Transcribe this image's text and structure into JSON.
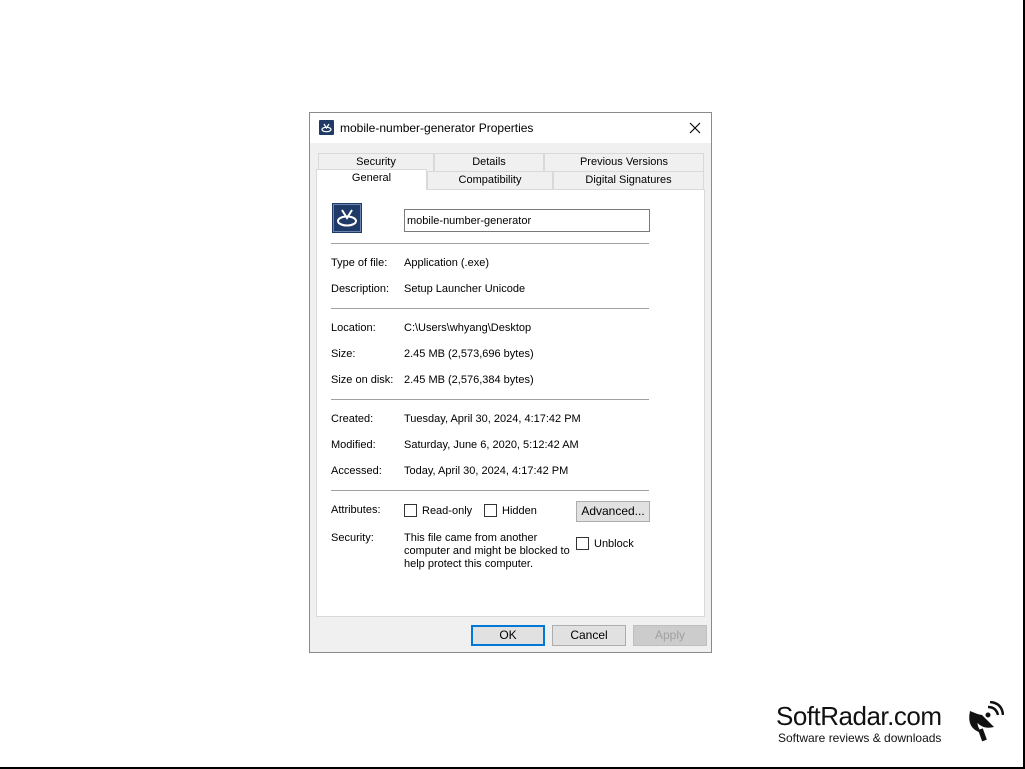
{
  "window": {
    "title": "mobile-number-generator Properties"
  },
  "tabs_row1": [
    "Security",
    "Details",
    "Previous Versions"
  ],
  "tabs_row2": [
    "General",
    "Compatibility",
    "Digital Signatures"
  ],
  "general": {
    "file_name": "mobile-number-generator",
    "type_label": "Type of file:",
    "type_value": "Application (.exe)",
    "description_label": "Description:",
    "description_value": "Setup Launcher Unicode",
    "location_label": "Location:",
    "location_value": "C:\\Users\\whyang\\Desktop",
    "size_label": "Size:",
    "size_value": "2.45 MB (2,573,696 bytes)",
    "size_on_disk_label": "Size on disk:",
    "size_on_disk_value": "2.45 MB (2,576,384 bytes)",
    "created_label": "Created:",
    "created_value": "Tuesday, April 30, 2024, 4:17:42 PM",
    "modified_label": "Modified:",
    "modified_value": "Saturday, June 6, 2020, 5:12:42 AM",
    "accessed_label": "Accessed:",
    "accessed_value": "Today, April 30, 2024, 4:17:42 PM",
    "attributes_label": "Attributes:",
    "readonly_label": "Read-only",
    "hidden_label": "Hidden",
    "advanced_label": "Advanced...",
    "security_label": "Security:",
    "security_text": "This file came from another computer and might be blocked to help protect this computer.",
    "unblock_label": "Unblock"
  },
  "buttons": {
    "ok": "OK",
    "cancel": "Cancel",
    "apply": "Apply"
  },
  "brand": {
    "name": "SoftRadar.com",
    "tagline": "Software reviews & downloads"
  },
  "icons": {
    "app": "installer-app-icon",
    "close": "close-icon",
    "brand_logo": "satellite-dish-icon"
  },
  "colors": {
    "accent": "#0078d7",
    "app_icon_bg": "#1f3a66"
  }
}
